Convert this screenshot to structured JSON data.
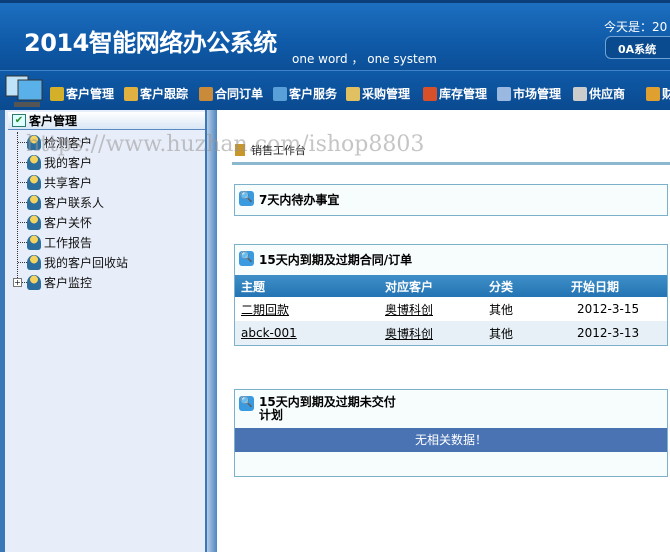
{
  "header": {
    "title": "2014智能网络办公系统",
    "slogan": "one word ， one system",
    "today": "今天是：20",
    "oa_tab": "0A系统"
  },
  "nav": [
    {
      "label": "客户管理",
      "color": "#d4b02a"
    },
    {
      "label": "客户跟踪",
      "color": "#e0b040"
    },
    {
      "label": "合同订单",
      "color": "#c98a3a"
    },
    {
      "label": "客户服务",
      "color": "#5aa0d8"
    },
    {
      "label": "采购管理",
      "color": "#e0c060"
    },
    {
      "label": "库存管理",
      "color": "#d8502a"
    },
    {
      "label": "市场管理",
      "color": "#9ab8e0"
    },
    {
      "label": "供应商",
      "color": "#cccccc"
    },
    {
      "label": "财",
      "color": "#e0a030"
    }
  ],
  "sidebar": {
    "title": "客户管理",
    "items": [
      "检测客户",
      "我的客户",
      "共享客户",
      "客户联系人",
      "客户关怀",
      "工作报告",
      "我的客户回收站",
      "客户监控"
    ]
  },
  "breadcrumb": "销售工作台",
  "panels": {
    "todo": {
      "title": "7天内待办事宜"
    },
    "contracts": {
      "title": "15天内到期及过期合同/订单",
      "columns": [
        "主题",
        "对应客户",
        "分类",
        "开始日期"
      ],
      "rows": [
        [
          "二期回款",
          "奥博科创",
          "其他",
          "2012-3-15"
        ],
        [
          "abck-001",
          "奥博科创",
          "其他",
          "2012-3-13"
        ]
      ]
    },
    "delivery": {
      "title": "15天内到期及过期未交付计划",
      "empty": "无相关数据！"
    }
  },
  "watermark": "https://www.huzhan.com/ishop8803"
}
